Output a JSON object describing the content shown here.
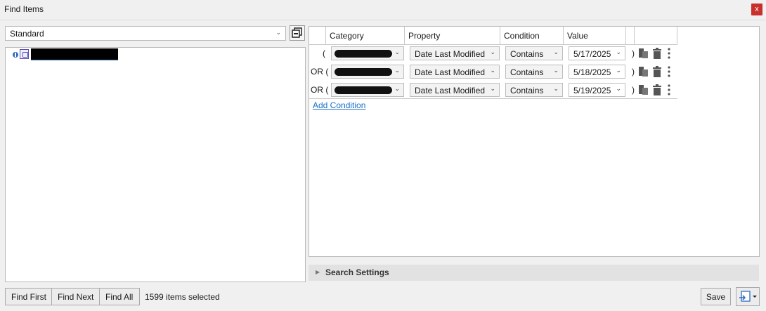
{
  "window": {
    "title": "Find Items",
    "close_label": "x"
  },
  "mode": {
    "selected": "Standard"
  },
  "headers": {
    "category": "Category",
    "property": "Property",
    "condition": "Condition",
    "value": "Value"
  },
  "conditions": [
    {
      "logic": "(",
      "property": "Date Last Modified",
      "condition": "Contains",
      "value": "5/17/2025",
      "close": ")"
    },
    {
      "logic": "OR (",
      "property": "Date Last Modified",
      "condition": "Contains",
      "value": "5/18/2025",
      "close": ")"
    },
    {
      "logic": "OR (",
      "property": "Date Last Modified",
      "condition": "Contains",
      "value": "5/19/2025",
      "close": ")"
    }
  ],
  "add_condition": "Add Condition",
  "search_settings": "Search Settings",
  "buttons": {
    "find_first": "Find First",
    "find_next": "Find Next",
    "find_all": "Find All",
    "save": "Save"
  },
  "status": "1599 items selected",
  "icons": {
    "copy": "copy-icon",
    "trash": "trash-icon",
    "more": "more-vertical-icon",
    "export": "export-icon"
  },
  "colors": {
    "close": "#c9302c",
    "link": "#1a6fc4",
    "tree_expand": "#2f6dc4"
  }
}
